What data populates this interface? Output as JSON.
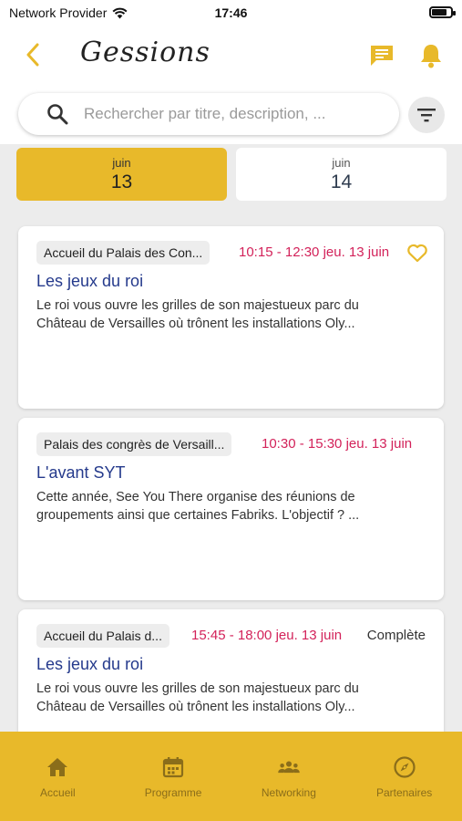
{
  "status": {
    "carrier": "Network Provider",
    "time": "17:46"
  },
  "header": {
    "title": "Gessions"
  },
  "search": {
    "placeholder": "Rechercher par titre, description, ..."
  },
  "dates": [
    {
      "month": "juin",
      "day": "13",
      "active": true
    },
    {
      "month": "juin",
      "day": "14",
      "active": false
    }
  ],
  "sessions": [
    {
      "location": "Accueil du Palais des Con...",
      "time": "10:15 - 12:30 jeu. 13 juin",
      "title": "Les jeux du roi",
      "desc1": "Le roi vous ouvre les grilles de son majestueux parc du",
      "desc2": "Château de Versailles où trônent les installations Oly...",
      "status": ""
    },
    {
      "location": "Palais des congrès de Versaill...",
      "time": "10:30 - 15:30 jeu. 13 juin",
      "title": "L'avant SYT",
      "desc1": "Cette année, See You There organise des réunions de",
      "desc2": "groupements ainsi que certaines Fabriks. L'objectif ? ...",
      "status": ""
    },
    {
      "location": "Accueil du Palais d...",
      "time": "15:45 - 18:00 jeu. 13 juin",
      "title": "Les jeux du roi",
      "desc1": "Le roi vous ouvre les grilles de son majestueux parc du",
      "desc2": "Château de Versailles où trônent les installations Oly...",
      "status": "Complète"
    }
  ],
  "tabs": [
    {
      "label": "Accueil",
      "icon": "home-icon"
    },
    {
      "label": "Programme",
      "icon": "calendar-icon"
    },
    {
      "label": "Networking",
      "icon": "people-icon"
    },
    {
      "label": "Partenaires",
      "icon": "compass-icon"
    }
  ],
  "colors": {
    "accent": "#e8b92a",
    "time": "#d3225a",
    "title": "#253a8c"
  }
}
